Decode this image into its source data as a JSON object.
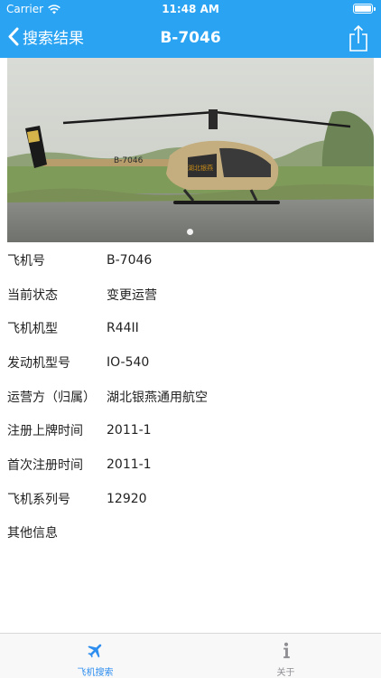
{
  "status_bar": {
    "carrier": "Carrier",
    "time": "11:48 AM"
  },
  "nav": {
    "back_label": "搜索结果",
    "title": "B-7046"
  },
  "photo": {
    "tail_number": "B-7046"
  },
  "details": [
    {
      "label": "飞机号",
      "value": "B-7046"
    },
    {
      "label": "当前状态",
      "value": "变更运营"
    },
    {
      "label": "飞机机型",
      "value": "R44II"
    },
    {
      "label": "发动机型号",
      "value": "IO-540"
    },
    {
      "label": "运营方（归属）",
      "value": "湖北银燕通用航空"
    },
    {
      "label": "注册上牌时间",
      "value": "2011-1"
    },
    {
      "label": "首次注册时间",
      "value": "2011-1"
    },
    {
      "label": "飞机系列号",
      "value": "12920"
    },
    {
      "label": "其他信息",
      "value": ""
    }
  ],
  "tabbar": {
    "tabs": [
      {
        "label": "飞机搜索",
        "icon": "airplane-icon",
        "active": true
      },
      {
        "label": "关于",
        "icon": "info-icon",
        "active": false
      }
    ]
  },
  "colors": {
    "accent": "#29a3f2",
    "tab_active": "#2e8ef0",
    "tab_inactive": "#8e8e93"
  }
}
